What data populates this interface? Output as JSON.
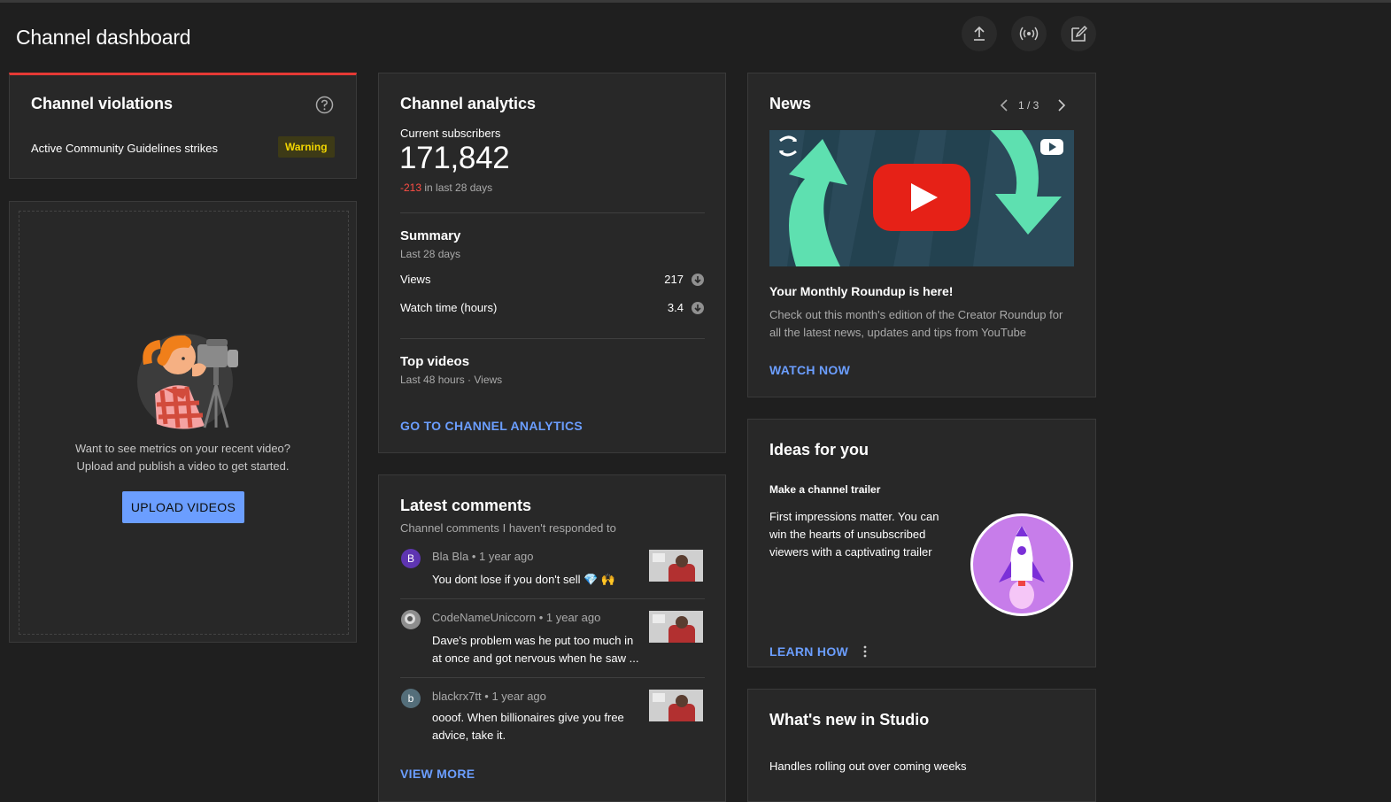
{
  "header": {
    "title": "Channel dashboard",
    "actions": [
      "upload-icon",
      "live-icon",
      "create-post-icon"
    ]
  },
  "violations": {
    "title": "Channel violations",
    "help_icon": "help-icon",
    "row_label": "Active Community Guidelines strikes",
    "badge": "Warning",
    "accent": "#e53935",
    "badge_bg": "#3d3a16",
    "badge_color": "#f2d600"
  },
  "upload_card": {
    "line1": "Want to see metrics on your recent video?",
    "line2": "Upload and publish a video to get started.",
    "button": "UPLOAD VIDEOS"
  },
  "analytics": {
    "title": "Channel analytics",
    "subs_label": "Current subscribers",
    "subs_value": "171,842",
    "subs_delta": "-213",
    "subs_delta_suffix": "in last 28 days",
    "summary_title": "Summary",
    "summary_sub": "Last 28 days",
    "rows": [
      {
        "label": "Views",
        "value": "217",
        "icon": "arrow-down-icon"
      },
      {
        "label": "Watch time (hours)",
        "value": "3.4",
        "icon": "arrow-down-icon"
      }
    ],
    "top_title": "Top videos",
    "top_sub": "Last 48 hours · Views",
    "link": "GO TO CHANNEL ANALYTICS"
  },
  "comments": {
    "title": "Latest comments",
    "sub": "Channel comments I haven't responded to",
    "items": [
      {
        "avatar": "B",
        "avatar_color": "#5e35b1",
        "author": "Bla Bla",
        "time": "1 year ago",
        "text": "You dont lose if you don't sell 💎 🙌"
      },
      {
        "avatar": "",
        "avatar_color": "#777777",
        "author": "CodeNameUniccorn",
        "time": "1 year ago",
        "text": "Dave's problem was he put too much in at once and got nervous when he saw ..."
      },
      {
        "avatar": "b",
        "avatar_color": "#546e7a",
        "author": "blackrx7tt",
        "time": "1 year ago",
        "text": "oooof. When billionaires give you free advice, take it."
      }
    ],
    "dot": "•",
    "link": "VIEW MORE"
  },
  "news": {
    "title": "News",
    "pager": "1 / 3",
    "headline": "Your Monthly Roundup is here!",
    "body": "Check out this month's edition of the Creator Roundup for all the latest news, updates and tips from YouTube",
    "link": "WATCH NOW"
  },
  "ideas": {
    "title": "Ideas for you",
    "subtitle": "Make a channel trailer",
    "body": "First impressions matter. You can win the hearts of unsubscribed viewers with a captivating trailer",
    "link": "LEARN HOW",
    "menu_icon": "more-vert-icon"
  },
  "whats_new": {
    "title": "What's new in Studio",
    "item": "Handles rolling out over coming weeks"
  }
}
